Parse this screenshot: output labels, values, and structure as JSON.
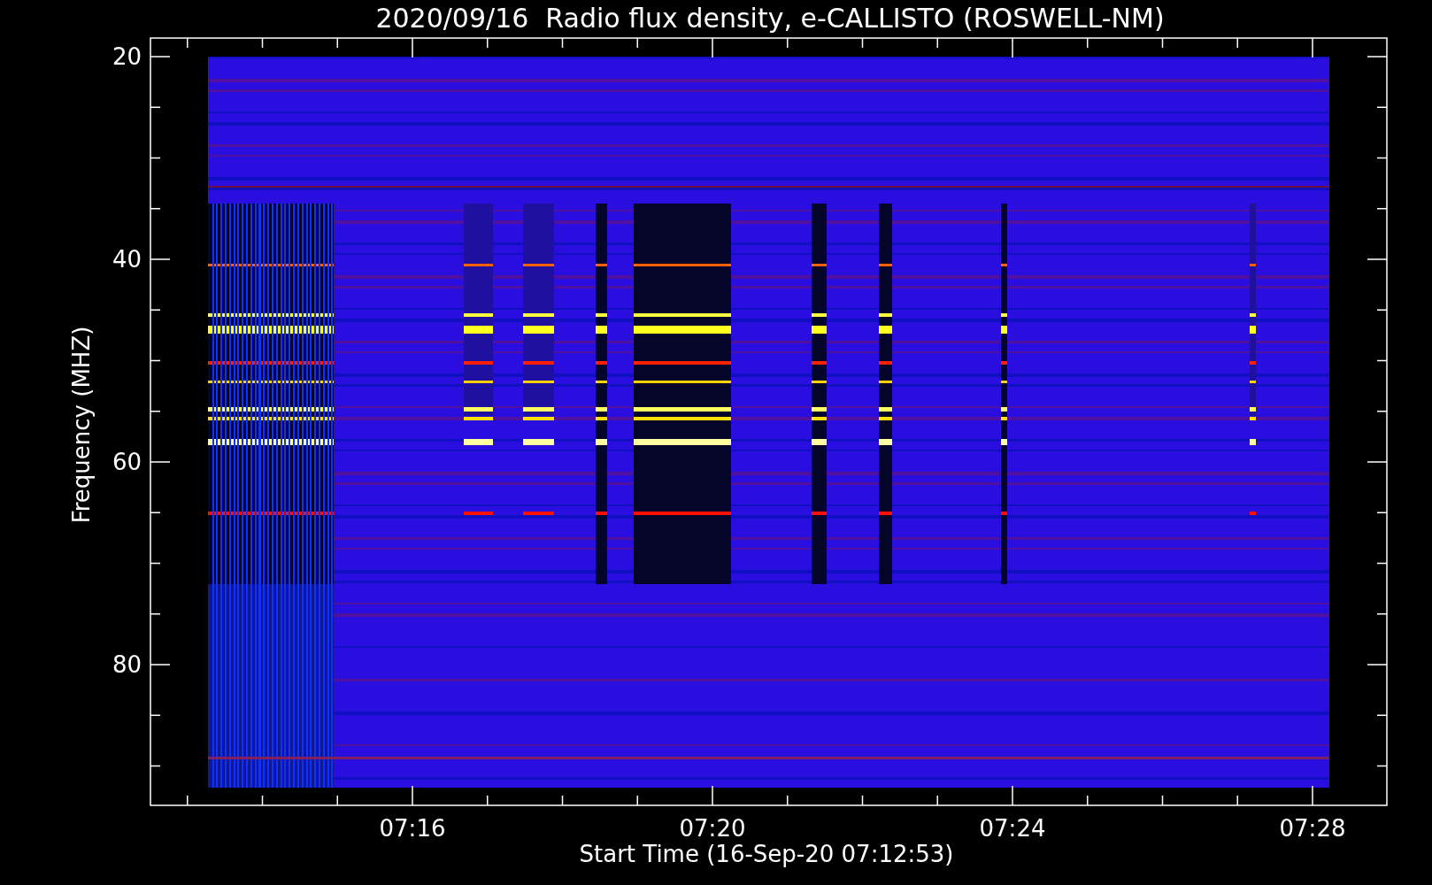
{
  "title": "2020/09/16  Radio flux density, e-CALLISTO (ROSWELL-NM)",
  "xlabel": "Start Time (16-Sep-20 07:12:53)",
  "ylabel": "Frequency (MHZ)",
  "yticks": [
    "20",
    "40",
    "60",
    "80"
  ],
  "xticks": [
    "07:16",
    "07:20",
    "07:24",
    "07:28"
  ]
}
